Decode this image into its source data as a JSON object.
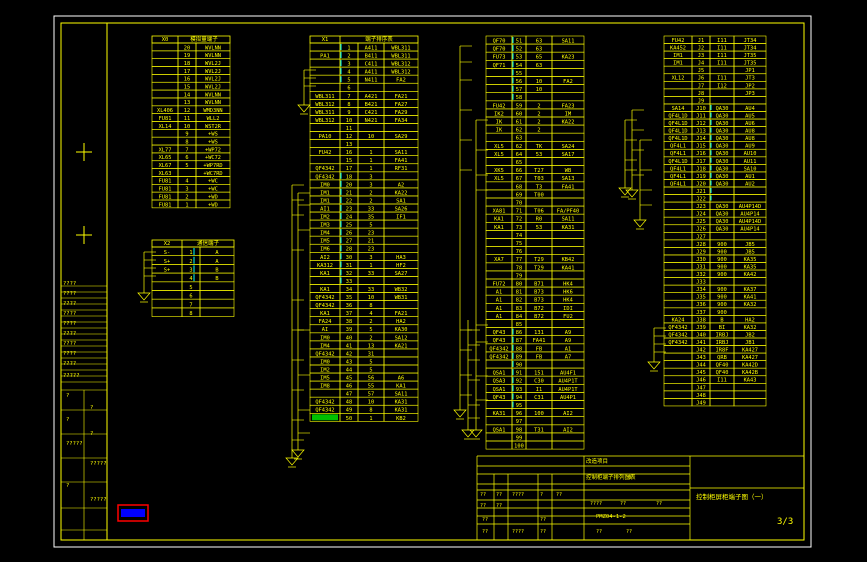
{
  "colors": {
    "canvas": "#000000",
    "page_border": "#ffffff",
    "frame": "#ffff00",
    "wire": "#ffff00",
    "highlight_cyan": "#00ffff",
    "highlight_green": "#00c000",
    "logo_red": "#ff0000",
    "logo_blue": "#0000ff"
  },
  "sheet_number": "3/3",
  "table_a": {
    "headers": [
      "X0",
      "模拟量端子"
    ],
    "rows": [
      [
        "",
        "20",
        "WVLNN"
      ],
      [
        "",
        "19",
        "WVLNN"
      ],
      [
        "",
        "18",
        "WVL2J"
      ],
      [
        "",
        "17",
        "WVL2J"
      ],
      [
        "",
        "16",
        "WVL2J"
      ],
      [
        "",
        "15",
        "WVL2J"
      ],
      [
        "",
        "14",
        "WVLNN"
      ],
      [
        "",
        "13",
        "WVLNN"
      ],
      [
        "XL406",
        "12",
        "WMD3NN"
      ],
      [
        "FU81",
        "11",
        "WLL2"
      ],
      [
        "XL14",
        "10",
        "WST2R"
      ],
      [
        "",
        "9",
        "+WS"
      ],
      [
        "",
        "8",
        "+WS"
      ],
      [
        "XL77",
        "7",
        "+WP72"
      ],
      [
        "XL65",
        "6",
        "+WC72"
      ],
      [
        "XL67",
        "5",
        "+WP7RD"
      ],
      [
        "XL63",
        "",
        "+WC7RD"
      ],
      [
        "FU81",
        "4",
        "+WC"
      ],
      [
        "FU81",
        "3",
        "+WC"
      ],
      [
        "FU81",
        "2",
        "+WD"
      ],
      [
        "FU81",
        "1",
        "+WD"
      ]
    ]
  },
  "table_b": {
    "headers": [
      "X2",
      "通信端子"
    ],
    "rows": [
      [
        "S-",
        "1",
        "A",
        "FA20"
      ],
      [
        "S+",
        "2",
        "A",
        "AH1"
      ],
      [
        "S+",
        "3",
        "B",
        "FA24"
      ],
      [
        "",
        "4",
        "B",
        "AH2"
      ],
      [
        "",
        "5",
        "",
        ""
      ],
      [
        "",
        "6",
        "",
        ""
      ],
      [
        "",
        "7",
        "",
        ""
      ],
      [
        "",
        "8",
        "",
        ""
      ]
    ]
  },
  "table_c": {
    "headers": [
      "X1",
      "端子排序表"
    ],
    "rows": [
      [
        "",
        "1",
        "A411",
        "WBL311"
      ],
      [
        "PA1",
        "2",
        "B411",
        "WBL311"
      ],
      [
        "",
        "3",
        "C411",
        "WBL312"
      ],
      [
        "",
        "4",
        "A411",
        "WBL312"
      ],
      [
        "",
        "5",
        "N411",
        "FA2"
      ],
      [
        "",
        "6",
        "",
        ""
      ],
      [
        "WBL311",
        "7",
        "A421",
        "FA21"
      ],
      [
        "WBL312",
        "8",
        "B421",
        "FA27"
      ],
      [
        "WBL311",
        "9",
        "C421",
        "FA29"
      ],
      [
        "WBL312",
        "10",
        "N421",
        "FA34"
      ],
      [
        "",
        "11",
        "",
        ""
      ],
      [
        "PA10",
        "12",
        "10",
        "SA29"
      ],
      [
        "",
        "13",
        "",
        ""
      ],
      [
        "FU42",
        "16",
        "1",
        "SA11"
      ],
      [
        "",
        "15",
        "1",
        "FA41"
      ],
      [
        "QF4342",
        "17",
        "1",
        "RF31"
      ],
      [
        "QF4342",
        "18",
        "3",
        ""
      ],
      [
        "IM0",
        "20",
        "3",
        "A2"
      ],
      [
        "IM1",
        "21",
        "2",
        "KA22"
      ],
      [
        "IM1",
        "22",
        "2",
        "SA1"
      ],
      [
        "AI1",
        "23",
        "33",
        "SA26"
      ],
      [
        "IM2",
        "24",
        "35",
        "IF1"
      ],
      [
        "IM3",
        "25",
        "5",
        ""
      ],
      [
        "IM4",
        "26",
        "23",
        ""
      ],
      [
        "IM5",
        "27",
        "21",
        ""
      ],
      [
        "IM6",
        "28",
        "23",
        ""
      ],
      [
        "AI2",
        "30",
        "3",
        "HA3"
      ],
      [
        "KA312",
        "31",
        "1",
        "HF2"
      ],
      [
        "KA1",
        "32",
        "33",
        "SA27"
      ],
      [
        "",
        "33",
        "",
        ""
      ],
      [
        "KA1",
        "34",
        "33",
        "WB32"
      ],
      [
        "QF4342",
        "35",
        "10",
        "WB31"
      ],
      [
        "QF4342",
        "36",
        "8",
        ""
      ],
      [
        "KA1",
        "37",
        "4",
        "FA21"
      ],
      [
        "FA24",
        "38",
        "2",
        "HA2"
      ],
      [
        "AI",
        "39",
        "5",
        "KA30"
      ],
      [
        "IM0",
        "40",
        "2",
        "SA12"
      ],
      [
        "IM4",
        "41",
        "13",
        "KA21"
      ],
      [
        "QF4342",
        "42",
        "31",
        ""
      ],
      [
        "IM0",
        "43",
        "5",
        ""
      ],
      [
        "IM2",
        "44",
        "5",
        ""
      ],
      [
        "IM5",
        "45",
        "56",
        "A6"
      ],
      [
        "IM8",
        "46",
        "55",
        "KA1"
      ],
      [
        "",
        "47",
        "57",
        "SA11"
      ],
      [
        "QF4342",
        "48",
        "10",
        "KA31"
      ],
      [
        "QF4342",
        "49",
        "8",
        "KA31"
      ],
      [
        "FA24",
        "50",
        "1",
        "KB2"
      ]
    ]
  },
  "table_d": {
    "headers": [],
    "rows": [
      [
        "QF70",
        "51",
        "63",
        "SA11"
      ],
      [
        "QF70",
        "52",
        "63",
        ""
      ],
      [
        "FU73",
        "53",
        "65",
        "KA23"
      ],
      [
        "QF71",
        "54",
        "63",
        ""
      ],
      [
        "",
        "55",
        "",
        ""
      ],
      [
        "",
        "56",
        "10",
        "FA2"
      ],
      [
        "",
        "57",
        "10",
        ""
      ],
      [
        "",
        "58",
        "",
        ""
      ],
      [
        "FU42",
        "59",
        "2",
        "FA23"
      ],
      [
        "IK2",
        "60",
        "2",
        "IM"
      ],
      [
        "IK",
        "61",
        "2",
        "KA22"
      ],
      [
        "IK",
        "62",
        "2",
        ""
      ],
      [
        "",
        "63",
        "",
        ""
      ],
      [
        "XL5",
        "62",
        "TK",
        "SA24"
      ],
      [
        "XL5",
        "64",
        "53",
        "SA17"
      ],
      [
        "",
        "65",
        "",
        ""
      ],
      [
        "XK5",
        "66",
        "T27",
        "WB"
      ],
      [
        "XL5",
        "67",
        "T03",
        "SA13"
      ],
      [
        "",
        "68",
        "T3",
        "FA41"
      ],
      [
        "",
        "69",
        "T00",
        ""
      ],
      [
        "",
        "70",
        "",
        ""
      ],
      [
        "XA81",
        "71",
        "T06",
        "FA/PF40"
      ],
      [
        "KA1",
        "72",
        "R0",
        "SA11"
      ],
      [
        "KA1",
        "73",
        "53",
        "KA31"
      ],
      [
        "",
        "74",
        "",
        ""
      ],
      [
        "",
        "75",
        "",
        ""
      ],
      [
        "",
        "76",
        "",
        ""
      ],
      [
        "XA7",
        "77",
        "T29",
        "KB42"
      ],
      [
        "",
        "78",
        "T29",
        "KA41"
      ],
      [
        "",
        "79",
        "",
        ""
      ],
      [
        "FU72",
        "80",
        "B71",
        "HK4"
      ],
      [
        "A1",
        "81",
        "B73",
        "HK6"
      ],
      [
        "A1",
        "82",
        "B73",
        "HK4"
      ],
      [
        "A1",
        "83",
        "B72",
        "IDI"
      ],
      [
        "A1",
        "84",
        "B72",
        "FU2"
      ],
      [
        "",
        "85",
        "",
        ""
      ],
      [
        "QF43",
        "86",
        "131",
        "A9"
      ],
      [
        "QF43",
        "87",
        "FA41",
        "A9"
      ],
      [
        "QF4342",
        "88",
        "FB",
        "A1"
      ],
      [
        "QF4342",
        "89",
        "FB",
        "A7"
      ],
      [
        "",
        "90",
        "",
        ""
      ],
      [
        "QSA1",
        "91",
        "151",
        "AU4F1"
      ],
      [
        "QSA3",
        "92",
        "C30",
        "AU4P1T"
      ],
      [
        "QSA1",
        "93",
        "I1",
        "AU4P1T"
      ],
      [
        "QF43",
        "94",
        "C31",
        "AU4P1"
      ],
      [
        "",
        "95",
        "",
        ""
      ],
      [
        "KA31",
        "96",
        "100",
        "AI2"
      ],
      [
        "",
        "97",
        "",
        ""
      ],
      [
        "QSA1",
        "98",
        "T31",
        "AI2"
      ],
      [
        "",
        "99",
        "",
        ""
      ],
      [
        "",
        "100",
        "",
        ""
      ]
    ]
  },
  "table_e": {
    "headers": [],
    "rows": [
      [
        "FU42",
        "J1",
        "I11",
        "JT34"
      ],
      [
        "KA452",
        "J2",
        "I11",
        "JT34"
      ],
      [
        "IM1",
        "J3",
        "I11",
        "JT35"
      ],
      [
        "IM1",
        "J4",
        "I11",
        "JT35"
      ],
      [
        "",
        "J5",
        "",
        "JP1"
      ],
      [
        "XL12",
        "J6",
        "I11",
        "JT3"
      ],
      [
        "",
        "J7",
        "I12",
        "JP2"
      ],
      [
        "",
        "J8",
        "",
        "JP3"
      ],
      [
        "",
        "J9",
        "",
        ""
      ],
      [
        "SA14",
        "J10",
        "QA30",
        "AU4"
      ],
      [
        "QF4L1D",
        "J11",
        "QA30",
        "AU5"
      ],
      [
        "QF4L1D",
        "J12",
        "QA30",
        "AU6"
      ],
      [
        "QF4L1D",
        "J13",
        "QA30",
        "AU8"
      ],
      [
        "QF4L1D",
        "J14",
        "QA30",
        "AU8"
      ],
      [
        "QF4L1",
        "J15",
        "QA30",
        "AU9"
      ],
      [
        "QF4L1",
        "J16",
        "QA30",
        "AU10"
      ],
      [
        "QF4L1D",
        "J17",
        "QA30",
        "AU11"
      ],
      [
        "QF4L1",
        "J18",
        "QA30",
        "SA10"
      ],
      [
        "QF4L1",
        "J19",
        "QA30",
        "AU1"
      ],
      [
        "QF4L1",
        "J20",
        "QA30",
        "AU2"
      ],
      [
        "",
        "J21",
        "",
        ""
      ],
      [
        "",
        "J22",
        "",
        ""
      ],
      [
        "",
        "J23",
        "QA30",
        "AU4P14D"
      ],
      [
        "",
        "J24",
        "QA30",
        "AU4P14"
      ],
      [
        "",
        "J25",
        "QA30",
        "AU4P14D"
      ],
      [
        "",
        "J26",
        "QA30",
        "AU4P14"
      ],
      [
        "",
        "J27",
        "",
        ""
      ],
      [
        "",
        "J28",
        "900",
        "JB5"
      ],
      [
        "",
        "J29",
        "900",
        "JB5"
      ],
      [
        "",
        "J30",
        "900",
        "KA35"
      ],
      [
        "",
        "J31",
        "900",
        "KA35"
      ],
      [
        "",
        "J32",
        "900",
        "KA42"
      ],
      [
        "",
        "J33",
        "",
        ""
      ],
      [
        "",
        "J34",
        "900",
        "KA37"
      ],
      [
        "",
        "J35",
        "900",
        "KA41"
      ],
      [
        "",
        "J36",
        "900",
        "KA32"
      ],
      [
        "",
        "J37",
        "900",
        ""
      ],
      [
        "KA24",
        "J38",
        "B",
        "HA2"
      ],
      [
        "QF4342",
        "J39",
        "BI",
        "KA32"
      ],
      [
        "QF4342",
        "J40",
        "IRBJ",
        "JB2"
      ],
      [
        "QF4342",
        "J41",
        "IRBJ",
        "JB1"
      ],
      [
        "",
        "J42",
        "IR8F",
        "KA427"
      ],
      [
        "",
        "J43",
        "QRB",
        "KA427"
      ],
      [
        "",
        "J44",
        "QF40",
        "KA42D"
      ],
      [
        "",
        "J45",
        "QF40",
        "KA42B"
      ],
      [
        "",
        "J46",
        "I11",
        "KA43"
      ],
      [
        "",
        "J47",
        "",
        ""
      ],
      [
        "",
        "J48",
        "",
        ""
      ],
      [
        "",
        "J49",
        "",
        ""
      ]
    ]
  },
  "left_strip_labels": [
    "????",
    "????",
    "????",
    "????",
    "????",
    "????",
    "????",
    "????",
    "????",
    "?????",
    "?",
    "?",
    "?",
    "?",
    "?????",
    "?????",
    "?",
    "?????"
  ],
  "title_block": {
    "company": "改造项目",
    "drawing_title": "控制柜端子排列图表",
    "drawing_number": "0",
    "sheet_title": "控制柜屏柜端子图（一）",
    "code": "PMZ04-1-2",
    "sign_cells": [
      "??",
      "??",
      "????",
      "?",
      "??",
      "??",
      "??",
      "??",
      "??",
      "??",
      "????",
      "????",
      "??",
      "??",
      "??",
      "??",
      "??"
    ]
  }
}
